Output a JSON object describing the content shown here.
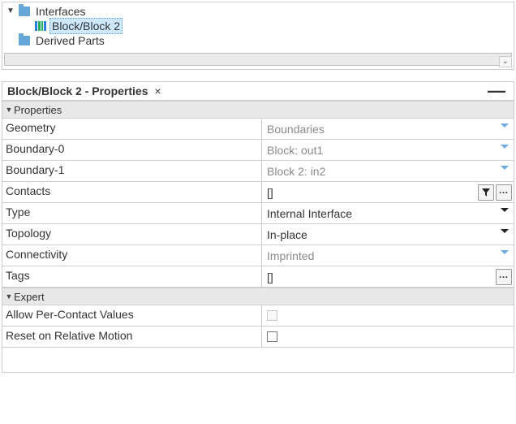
{
  "tree": {
    "interfaces_label": "Interfaces",
    "selected_item": "Block/Block 2",
    "derived_parts_label": "Derived Parts"
  },
  "panel": {
    "title": "Block/Block 2 - Properties",
    "close_glyph": "×",
    "minimize_glyph": "—"
  },
  "sections": {
    "properties": "Properties",
    "expert": "Expert"
  },
  "properties": [
    {
      "label": "Geometry",
      "value": "Boundaries",
      "dim": true,
      "arrow": "blue"
    },
    {
      "label": "Boundary-0",
      "value": "Block: out1",
      "dim": true,
      "arrow": "blue"
    },
    {
      "label": "Boundary-1",
      "value": "Block 2: in2",
      "dim": true,
      "arrow": "blue"
    },
    {
      "label": "Contacts",
      "value": "[]",
      "dim": false,
      "controls": [
        "filter",
        "ellipsis"
      ]
    },
    {
      "label": "Type",
      "value": "Internal Interface",
      "dim": false,
      "arrow": "black"
    },
    {
      "label": "Topology",
      "value": "In-place",
      "dim": false,
      "arrow": "black"
    },
    {
      "label": "Connectivity",
      "value": "Imprinted",
      "dim": true,
      "arrow": "blue"
    },
    {
      "label": "Tags",
      "value": "[]",
      "dim": false,
      "controls": [
        "ellipsis"
      ]
    }
  ],
  "expert": [
    {
      "label": "Allow Per-Contact Values",
      "checked": false,
      "disabled": true
    },
    {
      "label": "Reset on Relative Motion",
      "checked": false,
      "disabled": false
    }
  ]
}
